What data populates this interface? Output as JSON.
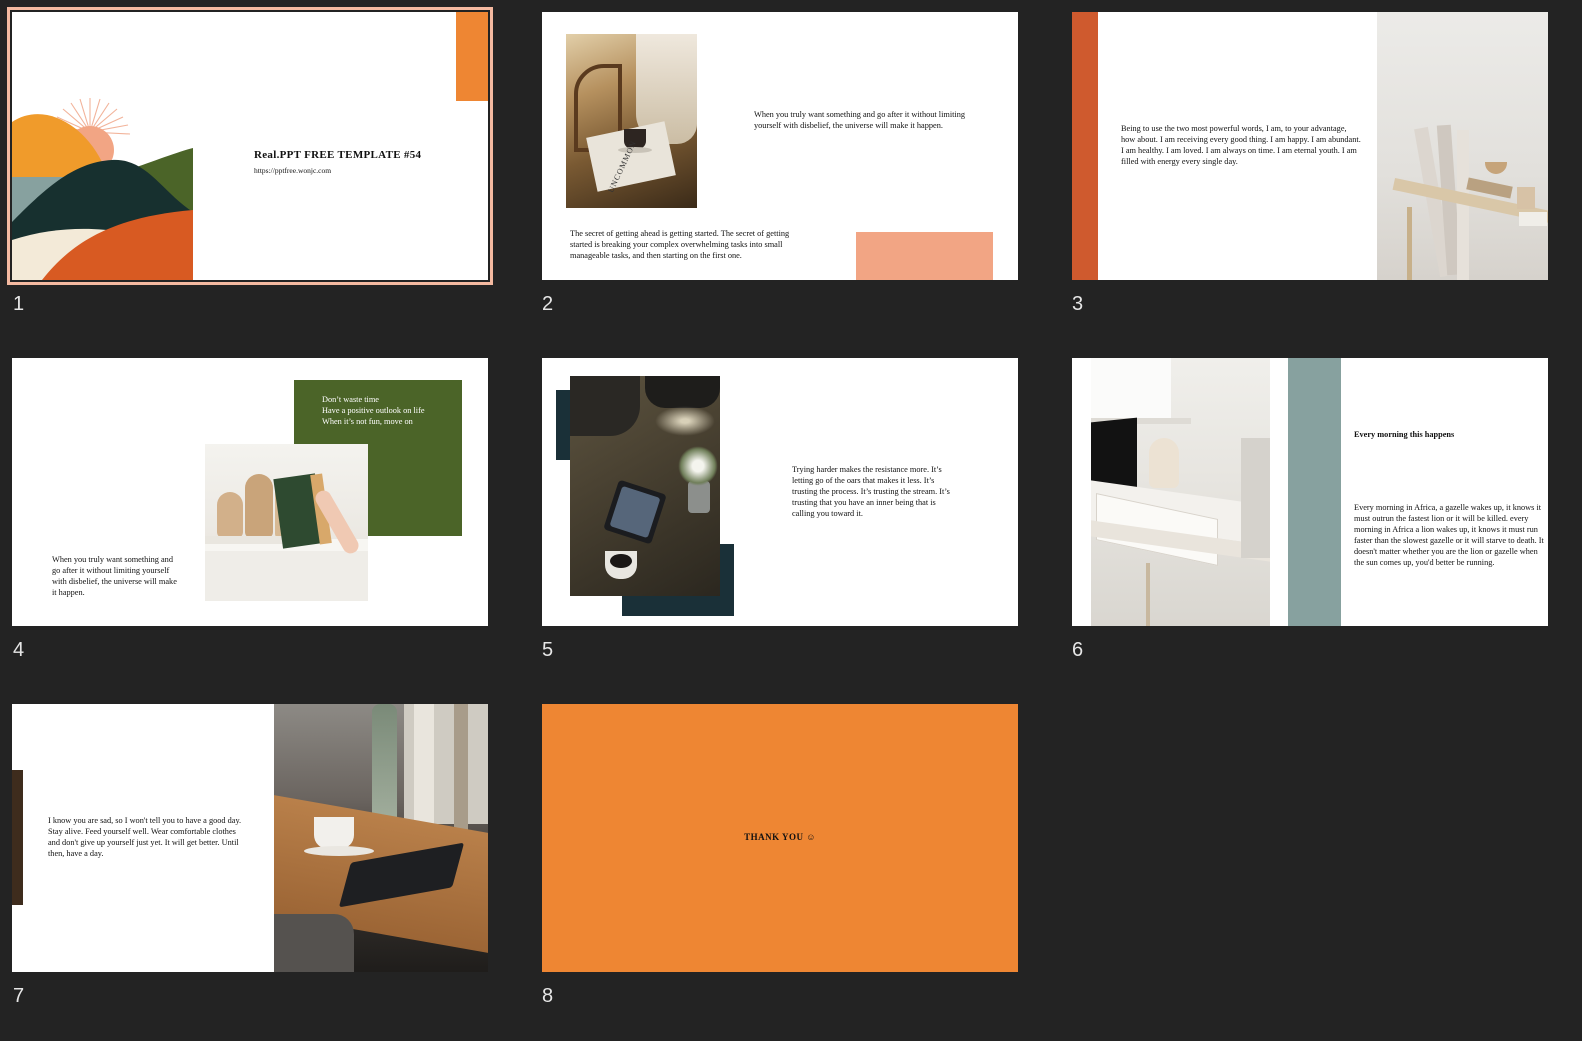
{
  "slides": [
    {
      "number": "1",
      "title": "Real.PPT FREE TEMPLATE #54",
      "url": "https://pptfree.wonjc.com"
    },
    {
      "number": "2",
      "text1": "When you truly want something and go after it without limiting yourself  with disbelief, the universe will make it happen.",
      "text2": "The secret of  getting ahead is getting started. The secret of getting started is breaking your complex overwhelming tasks into small manageable tasks, and then starting on the first one.",
      "photo_text": "UNCOMMON"
    },
    {
      "number": "3",
      "text": "Being to use the two most powerful words, I am, to your advantage, how about. I am receiving every good thing. I am happy. I am abundant. I am healthy. I am loved. I am always on time. I am eternal youth. I am filled with energy every single day."
    },
    {
      "number": "4",
      "green_lines": [
        "Don’t waste time",
        "Have a positive outlook on life",
        "When it’s not fun, move on"
      ],
      "text": "When you truly want something and go after it without limiting yourself  with disbelief, the universe will make it happen."
    },
    {
      "number": "5",
      "text": "Trying harder makes the resistance more. It’s letting go of  the oars that makes it less. It’s trusting the process. It’s trusting the stream. It’s trusting that you have an inner being that is calling you toward it."
    },
    {
      "number": "6",
      "heading": "Every morning this happens",
      "text": "Every morning in Africa, a gazelle wakes up, it knows it must outrun the fastest lion or it will be killed. every morning in Africa a lion wakes up, it knows it must run faster than the slowest gazelle or it will starve to death. It doesn't matter whether you are the lion or gazelle when the sun comes up, you'd better be running."
    },
    {
      "number": "7",
      "text": "I know you are sad, so I won't tell you to have a good day. Stay alive. Feed yourself  well. Wear comfortable clothes and don't give up yourself  just yet. It will get better. Until then, have a day."
    },
    {
      "number": "8",
      "text": "THANK YOU ☺"
    }
  ],
  "colors": {
    "background": "#232323",
    "orange": "#ee8633",
    "peach": "#f2a584",
    "rust": "#cf5a2e",
    "green": "#4b6428",
    "navy": "#1a3038",
    "sage": "#87a19f",
    "selected_outline": "#f4b9a0"
  },
  "selected_slide": 1
}
